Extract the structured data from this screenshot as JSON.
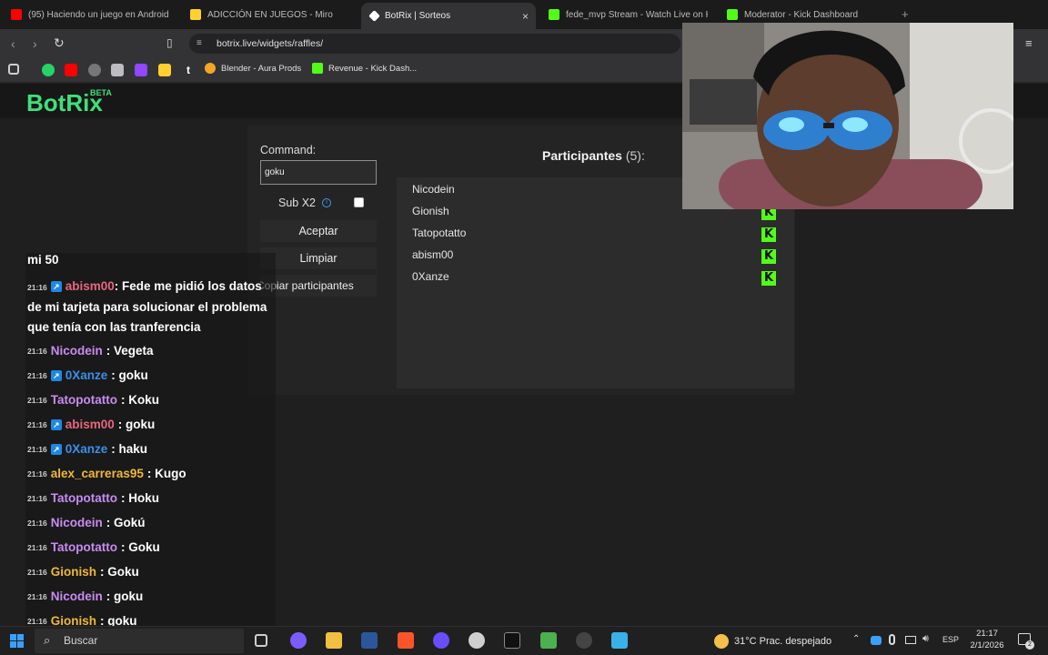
{
  "browser": {
    "tabs": [
      {
        "label": "(95) Haciendo un juego en Android",
        "color": "#ff0000"
      },
      {
        "label": "ADICCIÓN EN JUEGOS - Miro",
        "color": "#ffd02f"
      },
      {
        "label": "BotRix | Sorteos",
        "color": "#ffffff",
        "active": true
      },
      {
        "label": "fede_mvp Stream - Watch Live on Ki",
        "color": "#53fc18"
      },
      {
        "label": "Moderator - Kick Dashboard",
        "color": "#53fc18"
      }
    ],
    "close_glyph": "×",
    "new_tab_glyph": "+",
    "url": "botrix.live/widgets/raffles/",
    "bookmarks": [
      {
        "label": "Blender - Aura Prods",
        "color": "#f5a623"
      },
      {
        "label": "Revenue - Kick Dash...",
        "color": "#53fc18"
      }
    ]
  },
  "app": {
    "logo": "BotRix",
    "beta": "BETA"
  },
  "raffle": {
    "command_label": "Command:",
    "command_value": "goku",
    "sub_label": "Sub X2",
    "sub_checked": false,
    "accept": "Aceptar",
    "clear": "Limpiar",
    "copy": "Copiar participantes",
    "participants_title": "Participantes",
    "participants_count": "(5):",
    "participants": [
      "Nicodein",
      "Gionish",
      "Tatopotatto",
      "abism00",
      "0Xanze"
    ],
    "kick_glyph": "K"
  },
  "chat": {
    "first_line": "mi 50",
    "long_msg": {
      "time": "21:16",
      "user": "abism00",
      "color": "#e8677f",
      "badge": true,
      "text": ": Fede me pidió los datos de mi tarjeta para solucionar el problema que tenía con las tranferencia"
    },
    "messages": [
      {
        "time": "21:16",
        "user": "Nicodein",
        "color": "#c98cf2",
        "badge": false,
        "text": ": Vegeta"
      },
      {
        "time": "21:16",
        "user": "0Xanze",
        "color": "#3b8fe8",
        "badge": true,
        "text": ": goku"
      },
      {
        "time": "21:16",
        "user": "Tatopotatto",
        "color": "#c98cf2",
        "badge": false,
        "text": ": Koku"
      },
      {
        "time": "21:16",
        "user": "abism00",
        "color": "#e8677f",
        "badge": true,
        "text": ": goku"
      },
      {
        "time": "21:16",
        "user": "0Xanze",
        "color": "#3b8fe8",
        "badge": true,
        "text": ": haku"
      },
      {
        "time": "21:16",
        "user": "alex_carreras95",
        "color": "#f0b83a",
        "badge": false,
        "text": ": Kugo"
      },
      {
        "time": "21:16",
        "user": "Tatopotatto",
        "color": "#c98cf2",
        "badge": false,
        "text": ": Hoku"
      },
      {
        "time": "21:16",
        "user": "Nicodein",
        "color": "#c98cf2",
        "badge": false,
        "text": ": Gokú"
      },
      {
        "time": "21:16",
        "user": "Tatopotatto",
        "color": "#c98cf2",
        "badge": false,
        "text": ": Goku"
      },
      {
        "time": "21:16",
        "user": "Gionish",
        "color": "#f0b83a",
        "badge": false,
        "text": ": Goku"
      },
      {
        "time": "21:16",
        "user": "Nicodein",
        "color": "#c98cf2",
        "badge": false,
        "text": ": goku"
      },
      {
        "time": "21:16",
        "user": "Gionish",
        "color": "#f0b83a",
        "badge": false,
        "text": ": goku"
      }
    ]
  },
  "taskbar": {
    "search": "Buscar",
    "weather": "31°C  Prac. despejado",
    "lang": "ESP",
    "time": "21:17",
    "date": "2/1/2026",
    "notification_count": "2"
  }
}
